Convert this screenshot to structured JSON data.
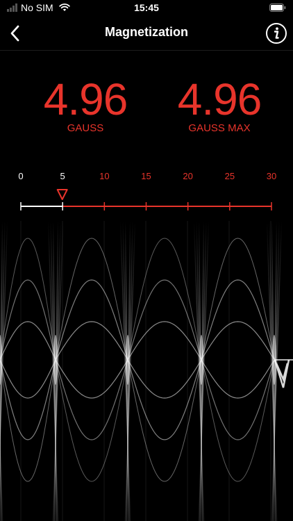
{
  "status": {
    "carrier": "No SIM",
    "time": "15:45"
  },
  "nav": {
    "title": "Magnetization"
  },
  "readings": {
    "current_value": "4.96",
    "current_unit": "GAUSS",
    "max_value": "4.96",
    "max_unit": "GAUSS MAX"
  },
  "scale": {
    "ticks": [
      "0",
      "5",
      "10",
      "15",
      "20",
      "25",
      "30"
    ],
    "min": 0,
    "max": 30,
    "current": 4.96,
    "below_color": "#ffffff",
    "above_color": "#e8342b"
  },
  "colors": {
    "accent": "#e8342b",
    "background": "#000000",
    "text": "#ffffff"
  },
  "icons": {
    "back": "chevron-left-icon",
    "info": "info-icon",
    "wifi": "wifi-icon",
    "signal": "signal-icon",
    "battery": "battery-icon"
  }
}
